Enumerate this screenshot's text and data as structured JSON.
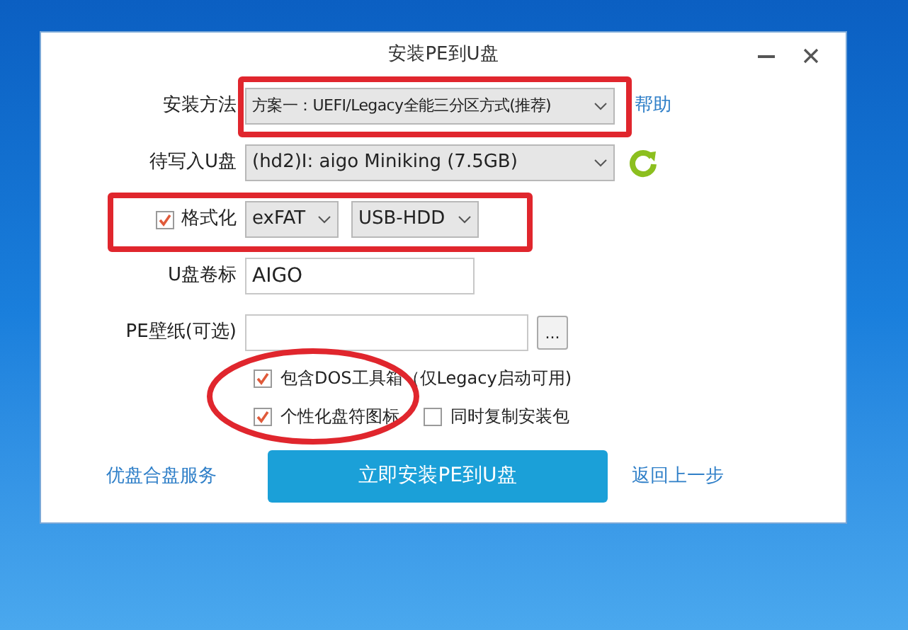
{
  "window": {
    "title": "安装PE到U盘"
  },
  "install_method": {
    "label": "安装方法",
    "value": "方案一：UEFI/Legacy全能三分区方式(推荐)",
    "help_link": "帮助"
  },
  "target_disk": {
    "label": "待写入U盘",
    "value": "(hd2)I: aigo Miniking (7.5GB)"
  },
  "format": {
    "label": "格式化",
    "checked": true,
    "filesystem": "exFAT",
    "mode": "USB-HDD"
  },
  "volume_label": {
    "label": "U盘卷标",
    "value": "AIGO"
  },
  "wallpaper": {
    "label": "PE壁纸(可选)",
    "browse": "..."
  },
  "options": [
    {
      "label": "包含DOS工具箱（仅Legacy启动可用)",
      "checked": true
    },
    {
      "label": "个性化盘符图标",
      "checked": true
    },
    {
      "label": "同时复制安装包",
      "checked": false
    }
  ],
  "footer": {
    "left_link": "优盘合盘服务",
    "install_button": "立即安装PE到U盘",
    "back_link": "返回上一步"
  }
}
